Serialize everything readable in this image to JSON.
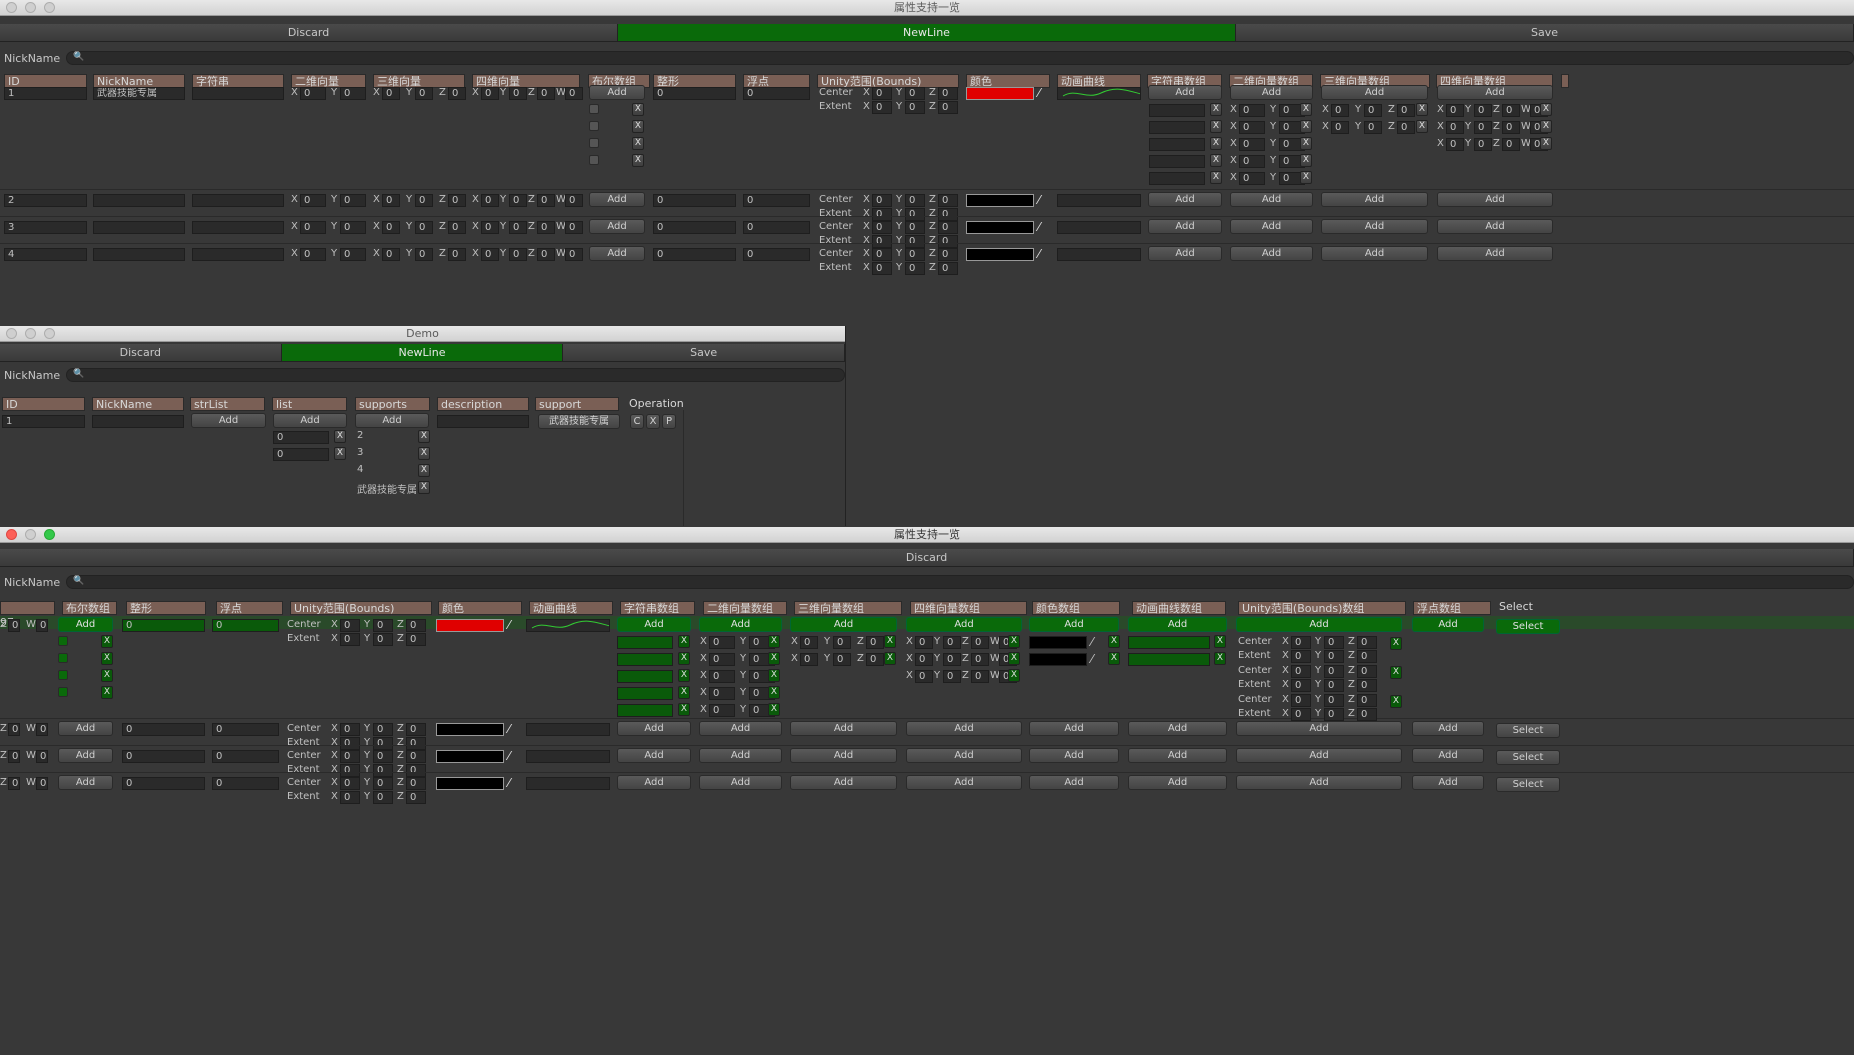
{
  "win1": {
    "title": "属性支持一览",
    "toolbar": [
      "Discard",
      "NewLine",
      "Save"
    ],
    "search_label": "NickName",
    "headers": [
      "ID",
      "NickName",
      "字符串",
      "二维向量",
      "三维向量",
      "四维向量",
      "布尔数组",
      "整形",
      "浮点",
      "Unity范围(Bounds)",
      "颜色",
      "动画曲线",
      "字符串数组",
      "二维向量数组",
      "三维向量数组",
      "四维向量数组"
    ],
    "rows": [
      {
        "id": "1",
        "nick": "武器技能专属"
      },
      {
        "id": "2",
        "nick": ""
      },
      {
        "id": "3",
        "nick": ""
      },
      {
        "id": "4",
        "nick": ""
      }
    ],
    "add": "Add",
    "x": "X",
    "zero": "0",
    "center": "Center",
    "extent": "Extent",
    "ax": [
      "X",
      "Y",
      "Z",
      "W"
    ]
  },
  "win2": {
    "title": "Demo",
    "toolbar": [
      "Discard",
      "NewLine",
      "Save"
    ],
    "search_label": "NickName",
    "headers": [
      "ID",
      "NickName",
      "strList",
      "list",
      "supports",
      "description",
      "support",
      "Operation"
    ],
    "row_id": "1",
    "list_vals": [
      "0",
      "0"
    ],
    "supports": [
      "2",
      "3",
      "4",
      "武器技能专属"
    ],
    "support_btn": "武器技能专属",
    "ops": [
      "C",
      "X",
      "P"
    ]
  },
  "win3": {
    "title": "属性支持一览",
    "toolbar": [
      "Discard"
    ],
    "search_label": "NickName",
    "headers": [
      "布尔数组",
      "整形",
      "浮点",
      "Unity范围(Bounds)",
      "颜色",
      "动画曲线",
      "字符串数组",
      "二维向量数组",
      "三维向量数组",
      "四维向量数组",
      "颜色数组",
      "动画曲线数组",
      "Unity范围(Bounds)数组",
      "浮点数组",
      "Select"
    ],
    "select": "Select"
  },
  "colors": {
    "green": "#0a6a0a",
    "red": "#e00000",
    "header": "#7a5f55"
  }
}
